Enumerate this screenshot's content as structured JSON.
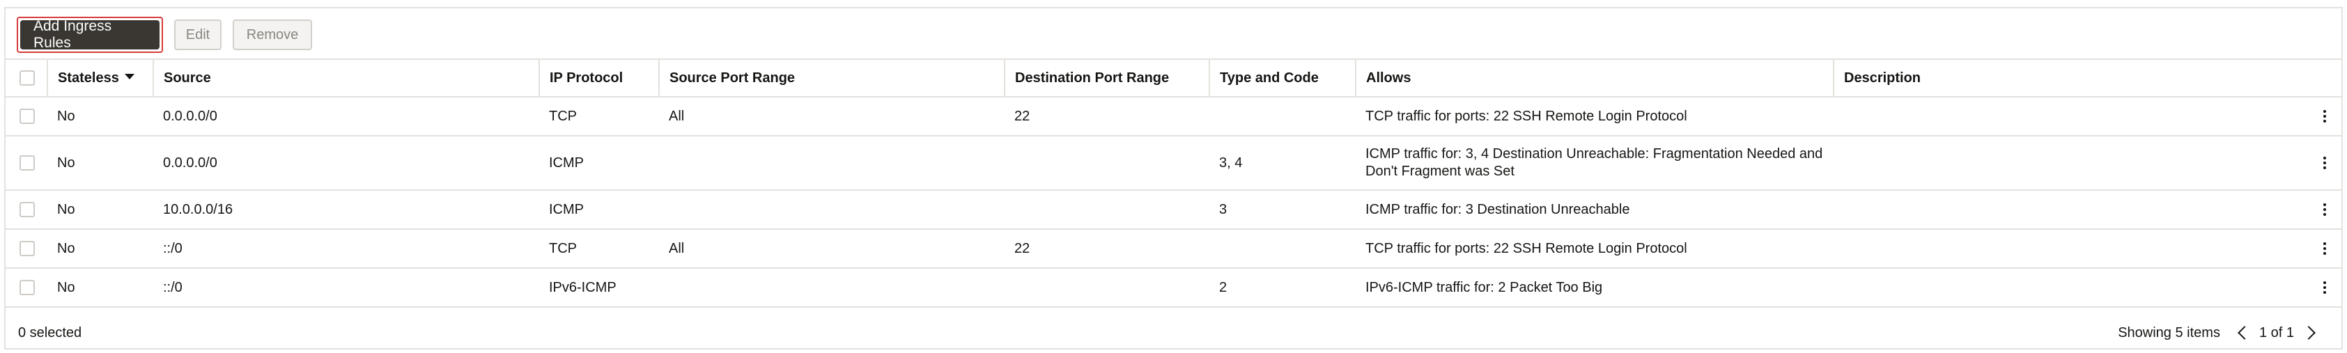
{
  "toolbar": {
    "add_label": "Add Ingress Rules",
    "edit_label": "Edit",
    "remove_label": "Remove"
  },
  "table": {
    "headers": {
      "stateless": "Stateless",
      "source": "Source",
      "ip_protocol": "IP Protocol",
      "source_port_range": "Source Port Range",
      "destination_port_range": "Destination Port Range",
      "type_and_code": "Type and Code",
      "allows": "Allows",
      "description": "Description"
    },
    "sort_column": "Stateless",
    "rows": [
      {
        "stateless": "No",
        "source": "0.0.0.0/0",
        "ip_protocol": "TCP",
        "source_port_range": "All",
        "destination_port_range": "22",
        "type_and_code": "",
        "allows": "TCP traffic for ports: 22 SSH Remote Login Protocol",
        "description": ""
      },
      {
        "stateless": "No",
        "source": "0.0.0.0/0",
        "ip_protocol": "ICMP",
        "source_port_range": "",
        "destination_port_range": "",
        "type_and_code": "3, 4",
        "allows": "ICMP traffic for: 3, 4 Destination Unreachable: Fragmentation Needed and Don't Fragment was Set",
        "description": ""
      },
      {
        "stateless": "No",
        "source": "10.0.0.0/16",
        "ip_protocol": "ICMP",
        "source_port_range": "",
        "destination_port_range": "",
        "type_and_code": "3",
        "allows": "ICMP traffic for: 3 Destination Unreachable",
        "description": ""
      },
      {
        "stateless": "No",
        "source": "::/0",
        "ip_protocol": "TCP",
        "source_port_range": "All",
        "destination_port_range": "22",
        "type_and_code": "",
        "allows": "TCP traffic for ports: 22 SSH Remote Login Protocol",
        "description": ""
      },
      {
        "stateless": "No",
        "source": "::/0",
        "ip_protocol": "IPv6-ICMP",
        "source_port_range": "",
        "destination_port_range": "",
        "type_and_code": "2",
        "allows": "IPv6-ICMP traffic for: 2 Packet Too Big",
        "description": ""
      }
    ]
  },
  "footer": {
    "selected_text": "0 selected",
    "showing_text": "Showing 5 items",
    "page_text": "1 of 1"
  },
  "colors": {
    "primary_button": "#3a3632",
    "focus_ring": "#d83a3a",
    "border": "#e4e1dd"
  },
  "icons": {
    "sort": "sort-descending-icon",
    "row_actions": "kebab-menu-icon",
    "prev": "chevron-left-icon",
    "next": "chevron-right-icon"
  }
}
